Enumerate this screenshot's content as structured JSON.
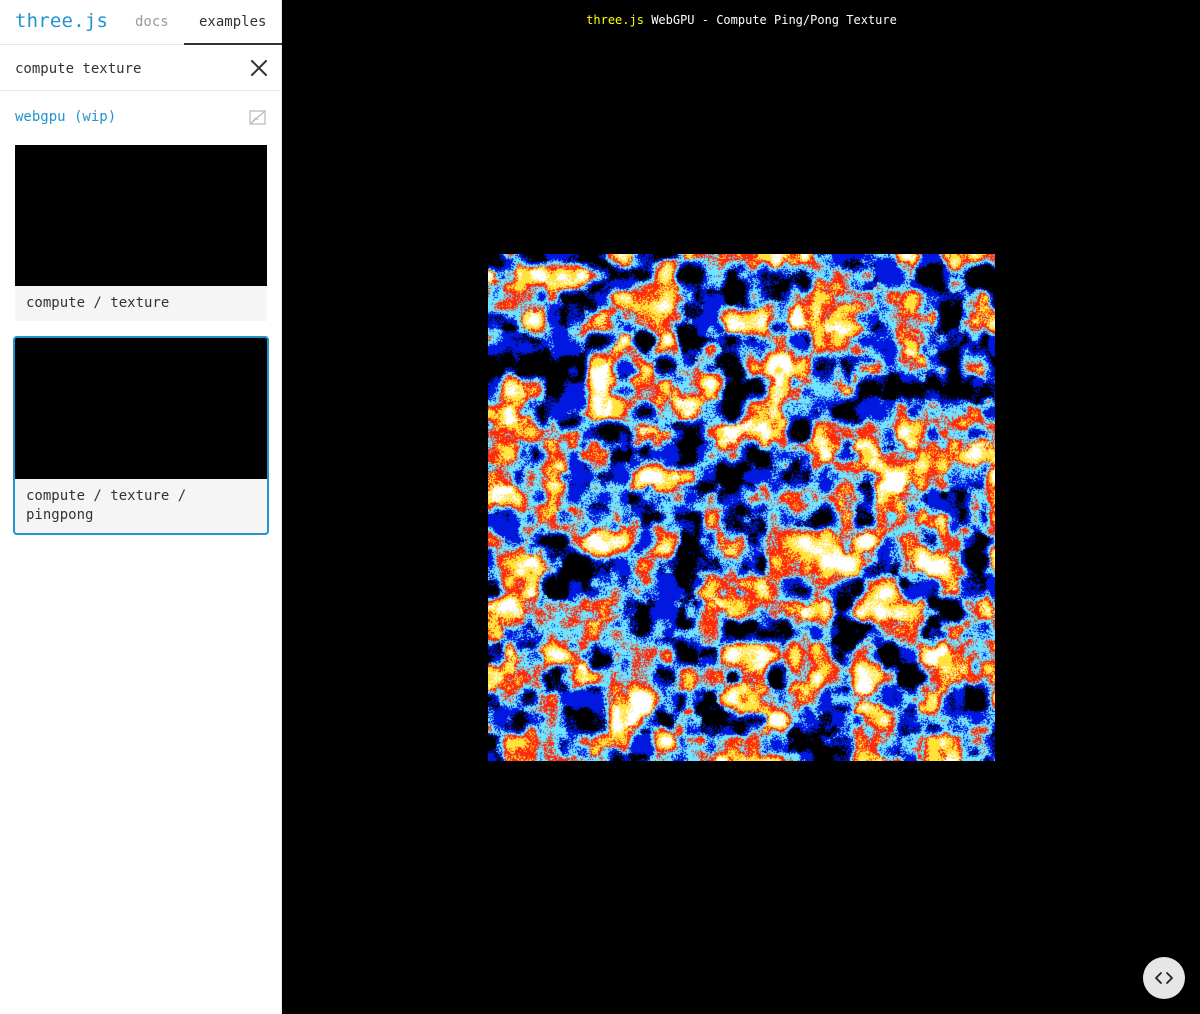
{
  "panel": {
    "logo": "three.js",
    "tabs": [
      {
        "label": "docs",
        "active": false
      },
      {
        "label": "examples",
        "active": true
      }
    ],
    "search": {
      "value": "compute texture",
      "placeholder": "Search"
    },
    "category": "webgpu (wip)",
    "examples": [
      {
        "label": "compute / texture",
        "selected": false
      },
      {
        "label": "compute / texture / pingpong",
        "selected": true
      }
    ]
  },
  "viewport": {
    "info_link": "three.js",
    "info_text": "WebGPU - Compute Ping/Pong Texture"
  },
  "colors": {
    "accent": "#2194ce",
    "info_link": "#ffff00",
    "noise_palette": [
      "#0018e0",
      "#ff2a0a",
      "#ffe23a",
      "#6fe4ff",
      "#ffffff",
      "#000000"
    ]
  },
  "icons": {
    "clear": "close-icon",
    "screenshot": "no-image-icon",
    "code": "code-icon"
  }
}
